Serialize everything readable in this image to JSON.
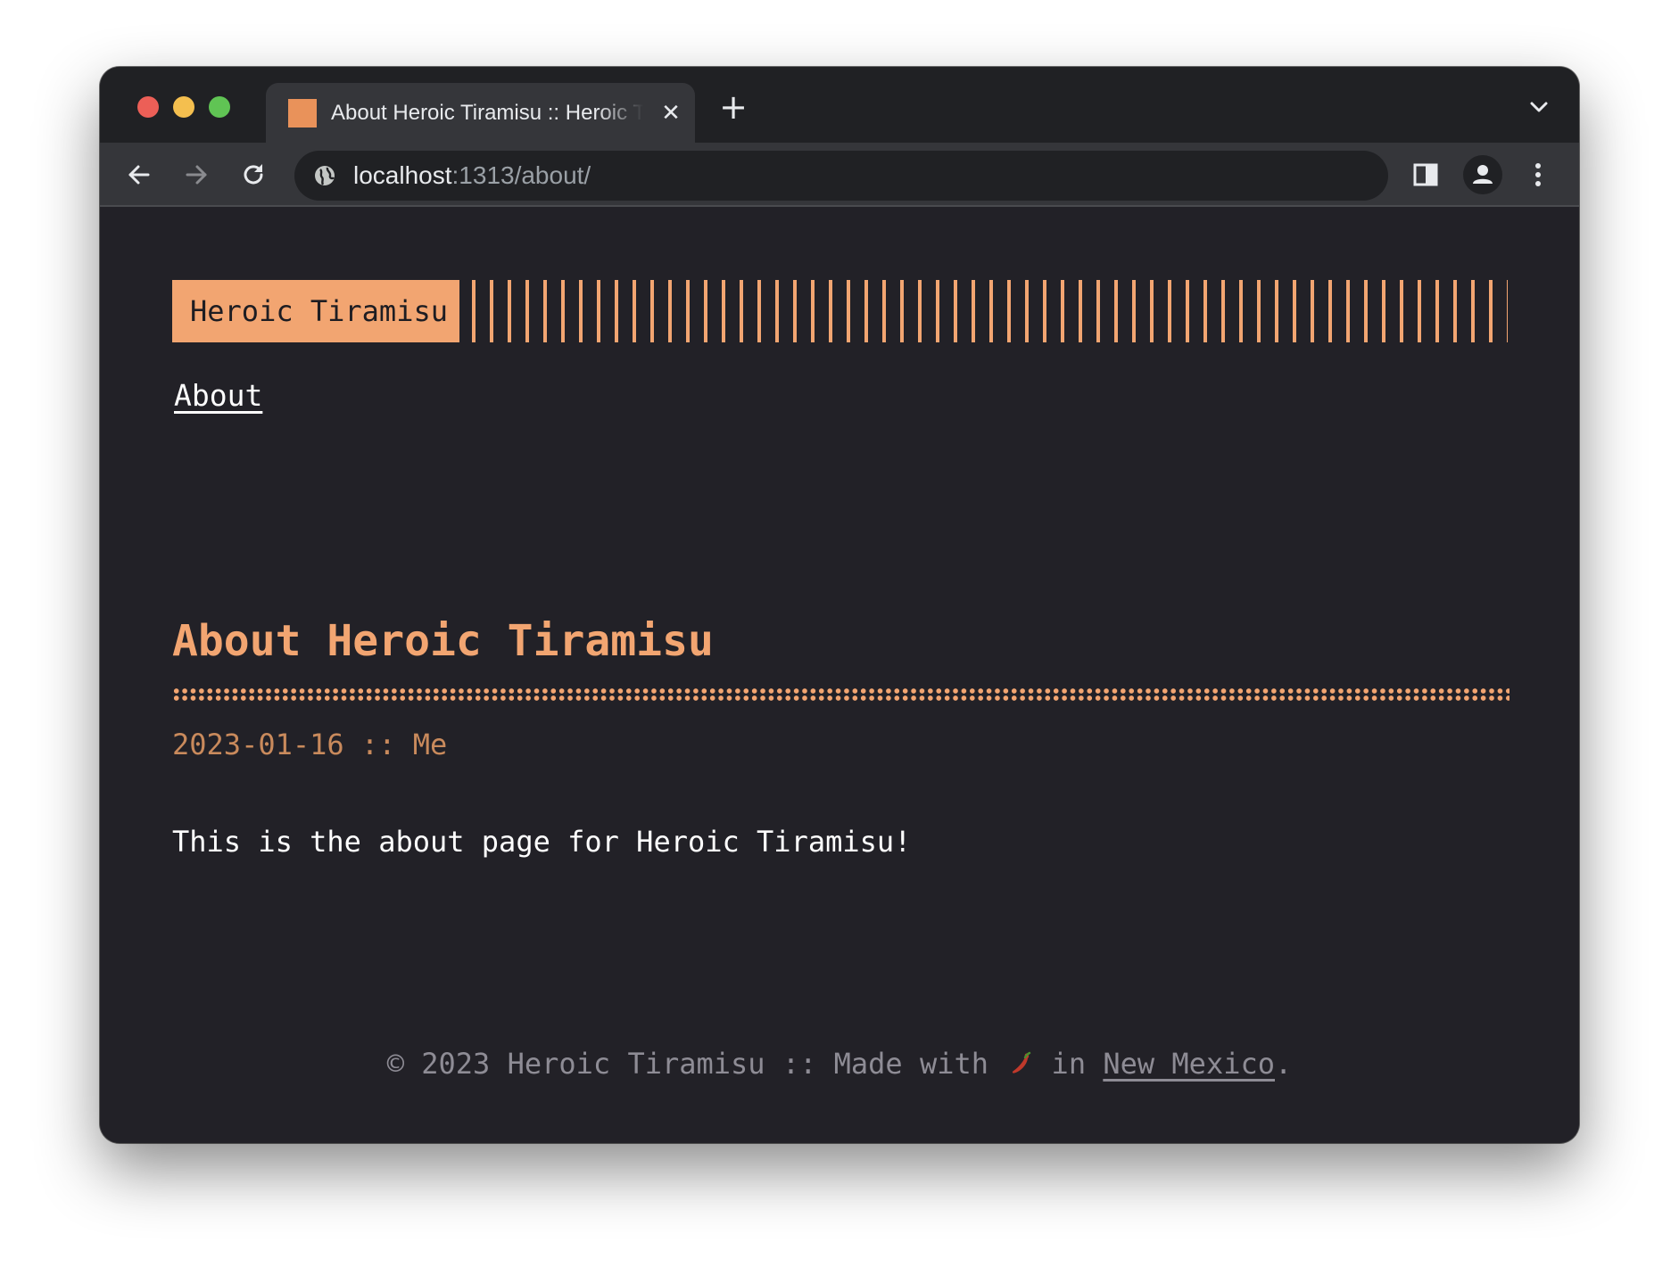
{
  "browser": {
    "tab": {
      "title": "About Heroic Tiramisu :: Heroic Tiramisu",
      "close_icon": "close-icon",
      "favicon_color": "#e9925a"
    },
    "new_tab_label": "+",
    "url": {
      "host": "localhost",
      "path": ":1313/about/"
    },
    "icons": [
      "back-arrow-icon",
      "forward-arrow-icon",
      "reload-icon",
      "globe-icon",
      "side-panel-icon",
      "profile-icon",
      "kebab-menu-icon",
      "chevron-down-icon"
    ]
  },
  "site": {
    "logo": "Heroic Tiramisu",
    "nav": [
      {
        "label": "About"
      }
    ],
    "accent_color": "#f2a571"
  },
  "post": {
    "title": "About Heroic Tiramisu",
    "meta": "2023-01-16 :: Me",
    "body": "This is the about page for Heroic Tiramisu!"
  },
  "footer": {
    "prefix": "© 2023 Heroic Tiramisu :: Made with ",
    "emoji_icon": "chili-pepper-icon",
    "middle": " in ",
    "link": "New Mexico",
    "suffix": "."
  }
}
